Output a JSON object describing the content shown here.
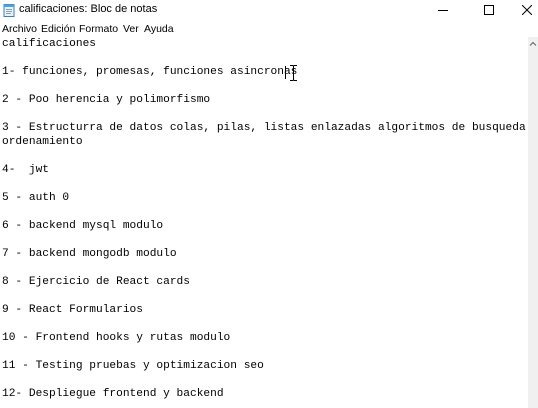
{
  "window": {
    "title": "calificaciones: Bloc de notas"
  },
  "menu": {
    "items": [
      "Archivo",
      "Edición",
      "Formato",
      "Ver",
      "Ayuda"
    ]
  },
  "editor": {
    "lines": [
      "calificaciones",
      "1- funciones, promesas, funciones asincronas",
      "2 - Poo herencia y polimorfismo",
      "3 - Estructurra de datos colas, pilas, listas enlazadas algoritmos de busqueda y",
      "ordenamiento",
      "4-  jwt",
      "5 - auth 0",
      "6 - backend mysql modulo",
      "7 - backend mongodb modulo",
      "8 - Ejercicio de React cards",
      "9 - React Formularios",
      "10 - Frontend hooks y rutas modulo",
      "11 - Testing pruebas y optimizacion seo",
      "12- Despliegue frontend y backend"
    ]
  },
  "icons": {
    "app": "notepad-icon",
    "minimize": "minimize-icon",
    "maximize": "maximize-icon",
    "close": "close-icon",
    "text_cursor": "ibeam-cursor-icon",
    "scroll_up": "scroll-up-arrow-icon"
  },
  "colors": {
    "text": "#000000",
    "background": "#ffffff",
    "scrollbar": "#f0f0f0"
  }
}
